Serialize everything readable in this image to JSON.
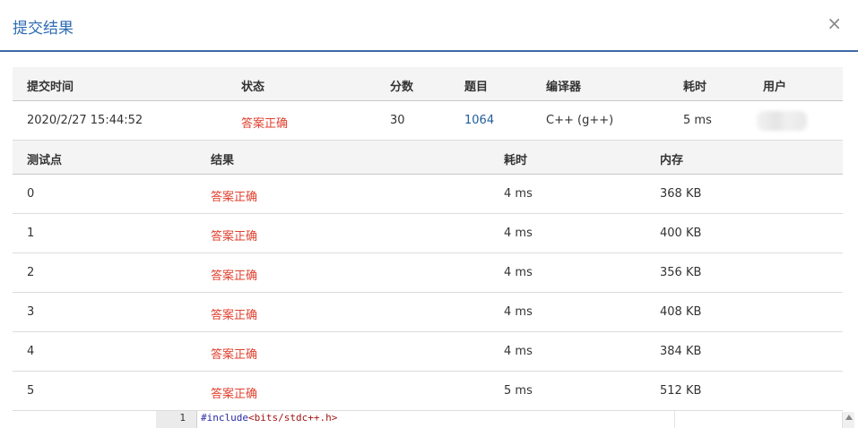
{
  "dialog": {
    "title": "提交结果",
    "close_label": "×"
  },
  "summary": {
    "headers": [
      "提交时间",
      "状态",
      "分数",
      "题目",
      "编译器",
      "耗时",
      "用户"
    ],
    "row": {
      "time": "2020/2/27 15:44:52",
      "status": "答案正确",
      "score": "30",
      "problem": "1064",
      "compiler": "C++ (g++)",
      "duration": "5 ms"
    }
  },
  "testcases": {
    "headers": [
      "测试点",
      "结果",
      "耗时",
      "内存"
    ],
    "rows": [
      {
        "id": "0",
        "result": "答案正确",
        "time": "4 ms",
        "memory": "368 KB"
      },
      {
        "id": "1",
        "result": "答案正确",
        "time": "4 ms",
        "memory": "400 KB"
      },
      {
        "id": "2",
        "result": "答案正确",
        "time": "4 ms",
        "memory": "356 KB"
      },
      {
        "id": "3",
        "result": "答案正确",
        "time": "4 ms",
        "memory": "408 KB"
      },
      {
        "id": "4",
        "result": "答案正确",
        "time": "4 ms",
        "memory": "384 KB"
      },
      {
        "id": "5",
        "result": "答案正确",
        "time": "5 ms",
        "memory": "512 KB"
      }
    ]
  },
  "code": {
    "line_number": "1",
    "directive": "#include",
    "header": "<bits/stdc++.h>"
  },
  "colors": {
    "accent": "#2e6bb5",
    "success": "#e0412f",
    "link": "#1f5c9c"
  }
}
